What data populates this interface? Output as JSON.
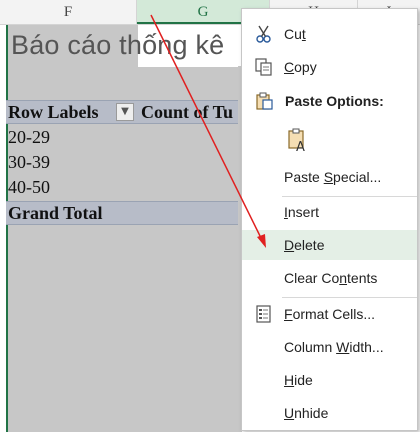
{
  "columns": [
    {
      "letter": "F"
    },
    {
      "letter": "G"
    },
    {
      "letter": "H"
    },
    {
      "letter": "I"
    }
  ],
  "sheet": {
    "title": "Báo cáo thống kê",
    "pivot": {
      "row_labels_header": "Row Labels",
      "value_header": "Count of Tu",
      "rows": [
        "20-29",
        "30-39",
        "40-50"
      ],
      "grand_total": "Grand Total"
    }
  },
  "context_menu": {
    "cut": {
      "pre": "Cu",
      "u": "t",
      "post": ""
    },
    "copy": {
      "pre": "",
      "u": "C",
      "post": "opy"
    },
    "paste_options": "Paste Options:",
    "paste_special": {
      "pre": "Paste ",
      "u": "S",
      "post": "pecial..."
    },
    "insert": {
      "pre": "",
      "u": "I",
      "post": "nsert"
    },
    "delete": {
      "pre": "",
      "u": "D",
      "post": "elete"
    },
    "clear_contents": {
      "pre": "Clear Co",
      "u": "n",
      "post": "tents"
    },
    "format_cells": {
      "pre": "",
      "u": "F",
      "post": "ormat Cells..."
    },
    "column_width": {
      "pre": "Column ",
      "u": "W",
      "post": "idth..."
    },
    "hide": {
      "pre": "",
      "u": "H",
      "post": "ide"
    },
    "unhide": {
      "pre": "",
      "u": "U",
      "post": "nhide"
    }
  },
  "colors": {
    "accent": "#217346",
    "selection_shade": "#c7c7c7",
    "pivot_header": "#b7bcc8",
    "arrow": "#e02020",
    "menu_hover": "#e4efe6"
  }
}
